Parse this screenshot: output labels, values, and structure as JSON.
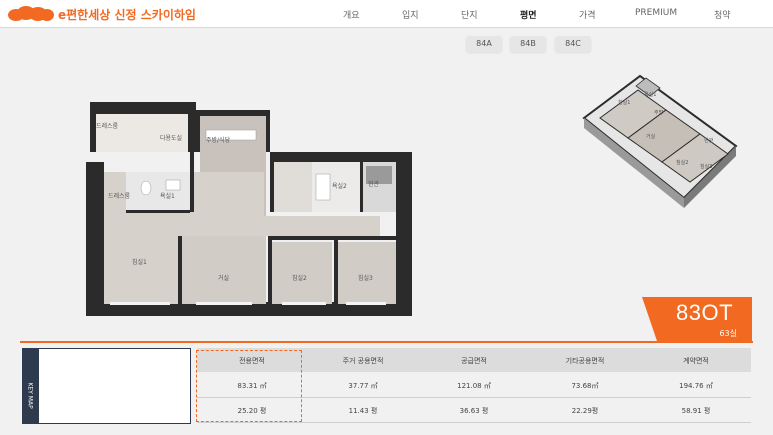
{
  "header": {
    "brand": "e편한세상 신정 스카이하임",
    "nav": [
      {
        "label": "개요",
        "active": false
      },
      {
        "label": "입지",
        "active": false
      },
      {
        "label": "단지",
        "active": false
      },
      {
        "label": "평면",
        "active": true
      },
      {
        "label": "가격",
        "active": false
      },
      {
        "label": "PREMIUM",
        "active": false
      },
      {
        "label": "청약",
        "active": false
      }
    ]
  },
  "type_tabs": [
    "84A",
    "84B",
    "84C"
  ],
  "floorplan": {
    "rooms": [
      "드레스룸",
      "다용도실",
      "주방/식당",
      "욕실1",
      "드레스룸",
      "욕실2",
      "현관",
      "침실1",
      "거실",
      "침실2",
      "침실3"
    ]
  },
  "iso_labels": [
    "침실1",
    "욕실1",
    "주방",
    "거실",
    "침실2",
    "침실3",
    "현관"
  ],
  "type_info": {
    "name": "83OT",
    "units": "63실"
  },
  "keymap": {
    "label": "KEY MAP"
  },
  "area_table": {
    "headers": [
      "전용면적",
      "주거 공용면적",
      "공급면적",
      "기타공용면적",
      "계약면적"
    ],
    "rows": [
      [
        "83.31 ㎡",
        "37.77 ㎡",
        "121.08 ㎡",
        "73.68㎡",
        "194.76 ㎡"
      ],
      [
        "25.20 평",
        "11.43 평",
        "36.63 평",
        "22.29평",
        "58.91 평"
      ]
    ]
  },
  "colors": {
    "accent": "#f26a21",
    "keymap": "#2e3a4e"
  }
}
